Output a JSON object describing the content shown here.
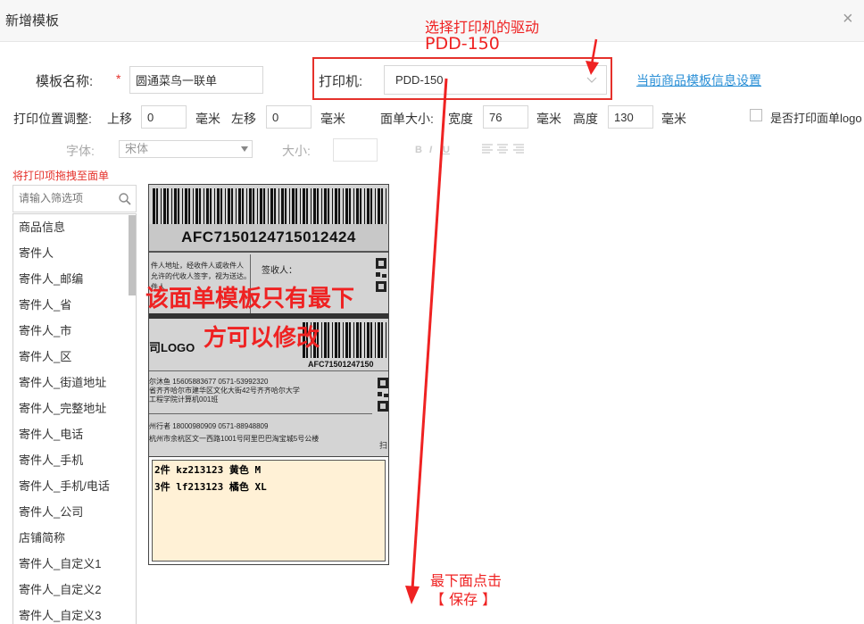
{
  "dialog": {
    "title": "新增模板",
    "close_glyph": "×"
  },
  "annotations": {
    "select_driver": "选择打印机的驱动",
    "driver_name": "PDD-150",
    "template_note_line1": "该面单模板只有最下",
    "template_note_line2": "方可以修改",
    "bottom_line1": "最下面点击",
    "bottom_line2": "【 保存 】"
  },
  "form": {
    "template_name_label": "模板名称:",
    "required_mark": "*",
    "template_name_value": "圆通菜鸟一联单",
    "printer_label": "打印机:",
    "printer_value": "PDD-150",
    "goods_settings_link": "当前商品模板信息设置",
    "offset_label": "打印位置调整:",
    "up_label": "上移",
    "up_value": "0",
    "up_unit": "毫米",
    "left_label": "左移",
    "left_value": "0",
    "left_unit": "毫米",
    "size_label": "面单大小:",
    "width_label": "宽度",
    "width_value": "76",
    "width_unit": "毫米",
    "height_label": "高度",
    "height_value": "130",
    "height_unit": "毫米",
    "logo_checkbox_label": "是否打印面单logo",
    "font_label": "字体:",
    "font_value": "宋体",
    "size_text_label": "大小:",
    "bold_glyph": "B",
    "italic_glyph": "I",
    "underline_glyph": "U"
  },
  "sidebar": {
    "drag_hint": "将打印项拖拽至面单",
    "search_placeholder": "请输入筛选项",
    "items": [
      "商品信息",
      "寄件人",
      "寄件人_邮编",
      "寄件人_省",
      "寄件人_市",
      "寄件人_区",
      "寄件人_街道地址",
      "寄件人_完整地址",
      "寄件人_电话",
      "寄件人_手机",
      "寄件人_手机/电话",
      "寄件人_公司",
      "店铺简称",
      "寄件人_自定义1",
      "寄件人_自定义2",
      "寄件人_自定义3"
    ]
  },
  "waybill": {
    "tracking_number": "AFC7150124715012424",
    "tracking_number_small": "AFC71501247150",
    "receiver_info_line1": "件人地址，经收件人或收件人",
    "receiver_info_line2": "允许的代收人签字，视为送达。",
    "receiver_info_line3": "件人",
    "sign_label": "签收人：",
    "logo_text": "司LOGO",
    "sender_line1": "尔沐鱼   15605883677   0571-53992320",
    "sender_line2": "省齐齐哈尔市建华区文化大街42号齐齐哈尔大学",
    "sender_line3": "工程学院计算机001班",
    "recipient_line1": "州行者     18000980909     0571-88948809",
    "recipient_line2": "杭州市余杭区文一西路1001号阿里巴巴淘宝城5号公楼",
    "side_char": "扫",
    "goods_line1": "2件 kz213123 黄色 M",
    "goods_line2": "3件 lf213123 橘色 XL"
  },
  "colors": {
    "annotation": "#ef2222",
    "link": "#2a8fd6",
    "goods_bg": "#fff1d6"
  }
}
